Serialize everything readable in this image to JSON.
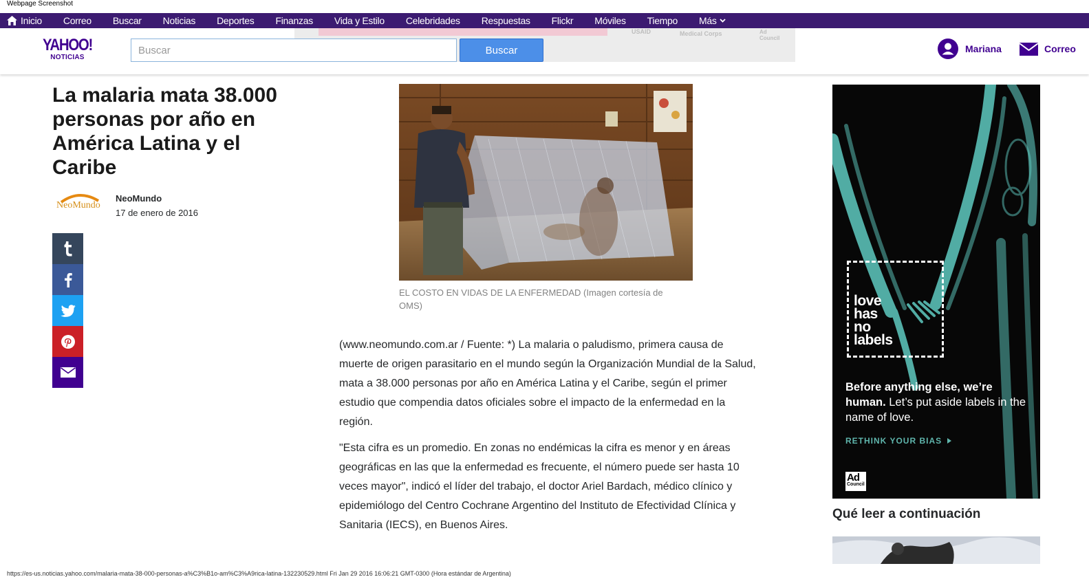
{
  "capture_label": "Webpage Screenshot",
  "nav": {
    "items": [
      "Inicio",
      "Correo",
      "Buscar",
      "Noticias",
      "Deportes",
      "Finanzas",
      "Vida y Estilo",
      "Celebridades",
      "Respuestas",
      "Flickr",
      "Móviles",
      "Tiempo",
      "Más"
    ]
  },
  "header": {
    "logo_main": "YAHOO!",
    "logo_sub": "NOTICIAS",
    "search_placeholder": "Buscar",
    "search_button": "Buscar",
    "user_name": "Mariana",
    "mail_label": "Correo",
    "banner_marks": [
      "USAID",
      "Medical Corps",
      "Ad Council"
    ]
  },
  "article": {
    "headline": "La malaria mata 38.000 personas por año en América Latina y el Caribe",
    "author_logo_text": "NeoMundo",
    "author_name": "NeoMundo",
    "date": "17 de enero de 2016",
    "image_caption": "EL COSTO EN VIDAS DE LA ENFERMEDAD (Imagen cortesía de OMS)",
    "paragraphs": [
      "(www.neomundo.com.ar / Fuente: *) La malaria o paludismo, primera causa de muerte de origen parasitario en el mundo según la Organización Mundial de la Salud, mata a 38.000 personas por año en América Latina y el Caribe, según el primer estudio que compendia datos oficiales sobre el impacto de la enfermedad en la región.",
      "\"Esta cifra es un promedio. En zonas no endémicas la cifra es menor y en áreas geográficas en las que la enfermedad es frecuente, el número puede ser hasta 10 veces mayor\", indicó el líder del trabajo, el doctor Ariel Bardach, médico clínico y epidemiólogo del Centro Cochrane Argentino del Instituto de Efectividad Clínica y Sanitaria (IECS), en Buenos Aires."
    ]
  },
  "share": {
    "buttons": [
      "tumblr",
      "facebook",
      "twitter",
      "pinterest",
      "email"
    ]
  },
  "side_ad": {
    "logo_lines": [
      "love",
      "has",
      "no",
      "labels"
    ],
    "headline_bold": "Before anything else, we’re human.",
    "headline_rest": " Let’s put aside labels in the name of love.",
    "cta": "RETHINK YOUR BIAS",
    "council_big": "Ad",
    "council_small": "Council"
  },
  "next_read": {
    "title": "Qué leer a continuación"
  },
  "status_url": "https://es-us.noticias.yahoo.com/malaria-mata-38-000-personas-a%C3%B1o-am%C3%A9rica-latina-132230529.html Fri Jan 29 2016 16:06:21 GMT-0300 (Hora estándar de Argentina)",
  "colors": {
    "nav_bg": "#3c1b71",
    "brand": "#400090",
    "search_button": "#4c8fe8"
  }
}
